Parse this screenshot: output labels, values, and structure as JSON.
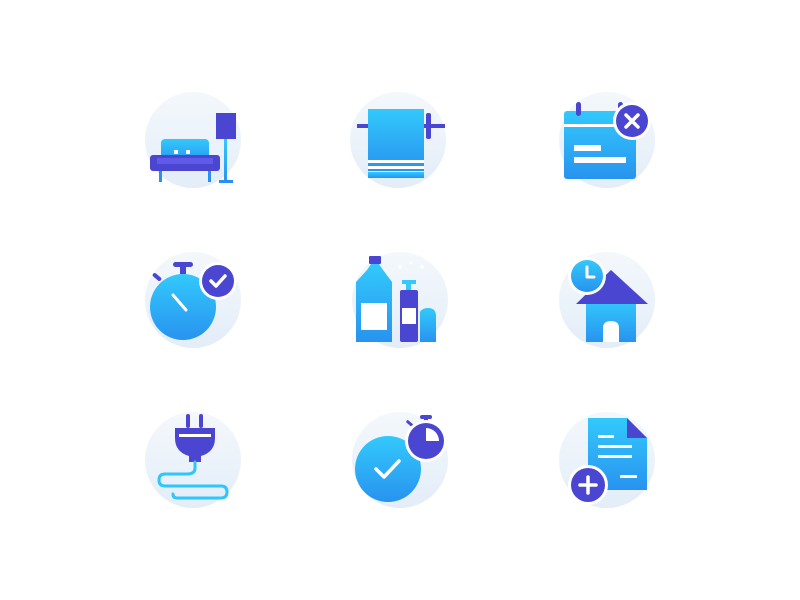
{
  "colors": {
    "background": "#ffffff",
    "circle_top": "#f3f7fb",
    "circle_bottom": "#e4eef8",
    "blue_light": "#2ec6fb",
    "blue_dark": "#2a8ff0",
    "purple": "#4a46d2",
    "purple_light": "#5f5ae8",
    "white": "#ffffff"
  },
  "icons": [
    "living-room-icon",
    "towel-icon",
    "calendar-cancel-icon",
    "stopwatch-check-icon",
    "cleaning-products-icon",
    "house-clock-icon",
    "power-plug-icon",
    "timer-check-icon",
    "add-document-icon"
  ]
}
